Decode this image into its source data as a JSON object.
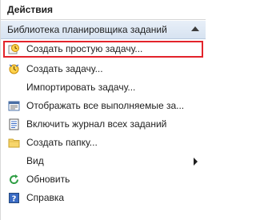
{
  "pane": {
    "title": "Действия"
  },
  "section": {
    "title": "Библиотека планировщика заданий"
  },
  "items": [
    {
      "label": "Создать простую задачу...",
      "icon": "basic-task-icon"
    },
    {
      "label": "Создать задачу...",
      "icon": "task-icon"
    },
    {
      "label": "Импортировать задачу...",
      "icon": ""
    },
    {
      "label": "Отображать все выполняемые за...",
      "icon": "running-tasks-icon"
    },
    {
      "label": "Включить журнал всех заданий",
      "icon": "history-log-icon"
    },
    {
      "label": "Создать папку...",
      "icon": "folder-icon"
    },
    {
      "label": "Вид",
      "icon": ""
    },
    {
      "label": "Обновить",
      "icon": "refresh-icon"
    },
    {
      "label": "Справка",
      "icon": "help-icon"
    }
  ],
  "colors": {
    "highlight_border": "#e3242b",
    "section_bg": "#d7e3f1"
  }
}
